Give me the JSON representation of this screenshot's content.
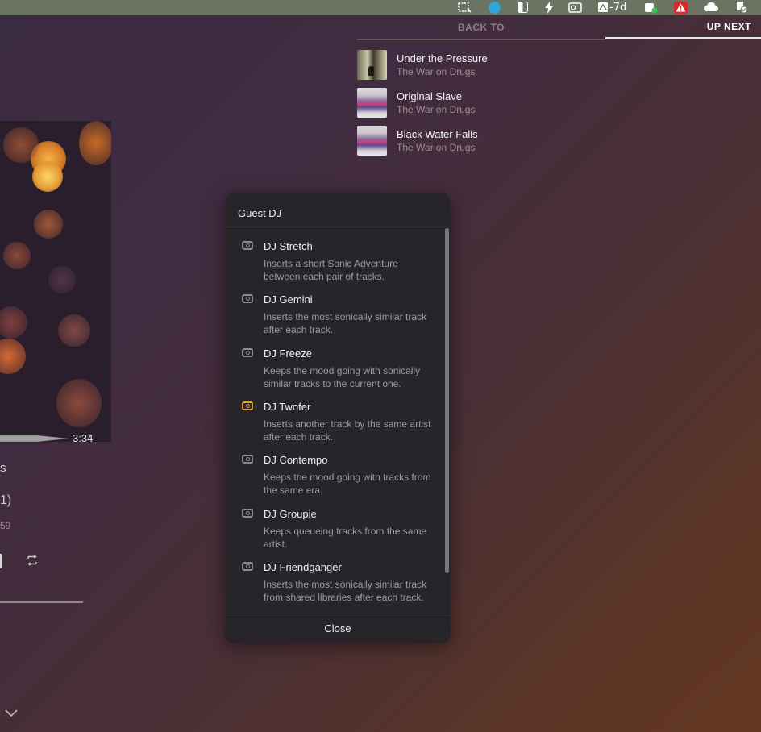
{
  "menubar": {
    "items": [
      {
        "icon": "screenshot-icon"
      },
      {
        "icon": "search-app-icon"
      },
      {
        "icon": "window-split-icon"
      },
      {
        "icon": "bolt-icon"
      },
      {
        "icon": "outlook-icon"
      },
      {
        "icon": "calendar-icon",
        "label": "-7d"
      },
      {
        "icon": "teams-icon"
      },
      {
        "icon": "warning-icon"
      },
      {
        "icon": "cloud-icon"
      },
      {
        "icon": "shield-check-icon"
      }
    ]
  },
  "player": {
    "time_end": "3:34",
    "fragments": [
      "s",
      "1)",
      "59"
    ]
  },
  "tabs": {
    "back_to": "BACK TO",
    "up_next": "UP NEXT"
  },
  "queue": [
    {
      "title": "Under the Pressure",
      "artist": "The War on Drugs"
    },
    {
      "title": "Original Slave",
      "artist": "The War on Drugs"
    },
    {
      "title": "Black Water Falls",
      "artist": "The War on Drugs"
    }
  ],
  "guest_dj": {
    "title": "Guest DJ",
    "items": [
      {
        "name": "DJ Stretch",
        "desc": "Inserts a short Sonic Adventure between each pair of tracks."
      },
      {
        "name": "DJ Gemini",
        "desc": "Inserts the most sonically similar track after each track."
      },
      {
        "name": "DJ Freeze",
        "desc": "Keeps the mood going with sonically similar tracks to the current one."
      },
      {
        "name": "DJ Twofer",
        "desc": "Inserts another track by the same artist after each track."
      },
      {
        "name": "DJ Contempo",
        "desc": "Keeps the mood going with tracks from the same era."
      },
      {
        "name": "DJ Groupie",
        "desc": "Keeps queueing tracks from the same artist."
      },
      {
        "name": "DJ Friendgänger",
        "desc": "Inserts the most sonically similar track from shared libraries after each track."
      }
    ],
    "active": "DJ Twofer",
    "close": "Close"
  },
  "colors": {
    "accent": "#e8a12a",
    "popup_bg": "#28252a"
  }
}
